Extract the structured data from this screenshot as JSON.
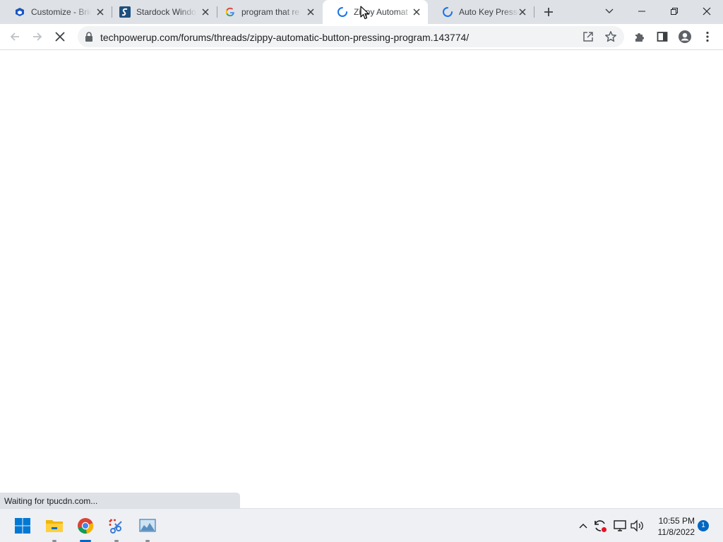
{
  "browser": {
    "tabs": [
      {
        "title": "Customize - Bric",
        "favicon": "shield-cube-icon",
        "active": false,
        "loading": false
      },
      {
        "title": "Stardock Windo",
        "favicon": "stardock-icon",
        "active": false,
        "loading": false
      },
      {
        "title": "program that re",
        "favicon": "google-icon",
        "active": false,
        "loading": false
      },
      {
        "title": "Zippy Automat",
        "favicon": "loading-spinner-icon",
        "active": true,
        "loading": true
      },
      {
        "title": "Auto Key Presse",
        "favicon": "loading-spinner-icon",
        "active": false,
        "loading": true
      }
    ],
    "toolbar": {
      "url": "techpowerup.com/forums/threads/zippy-automatic-button-pressing-program.143774/"
    },
    "status_text": "Waiting for tpucdn.com..."
  },
  "taskbar": {
    "apps": [
      {
        "name": "start-icon"
      },
      {
        "name": "file-explorer-icon"
      },
      {
        "name": "chrome-icon"
      },
      {
        "name": "snipping-tool-icon"
      },
      {
        "name": "photo-viewer-icon"
      }
    ],
    "clock": {
      "time": "10:55 PM",
      "date": "11/8/2022"
    },
    "notification_count": "1"
  },
  "colors": {
    "tabstrip": "#dee1e6",
    "accent": "#0067c0",
    "loading": "#1a73e8"
  }
}
